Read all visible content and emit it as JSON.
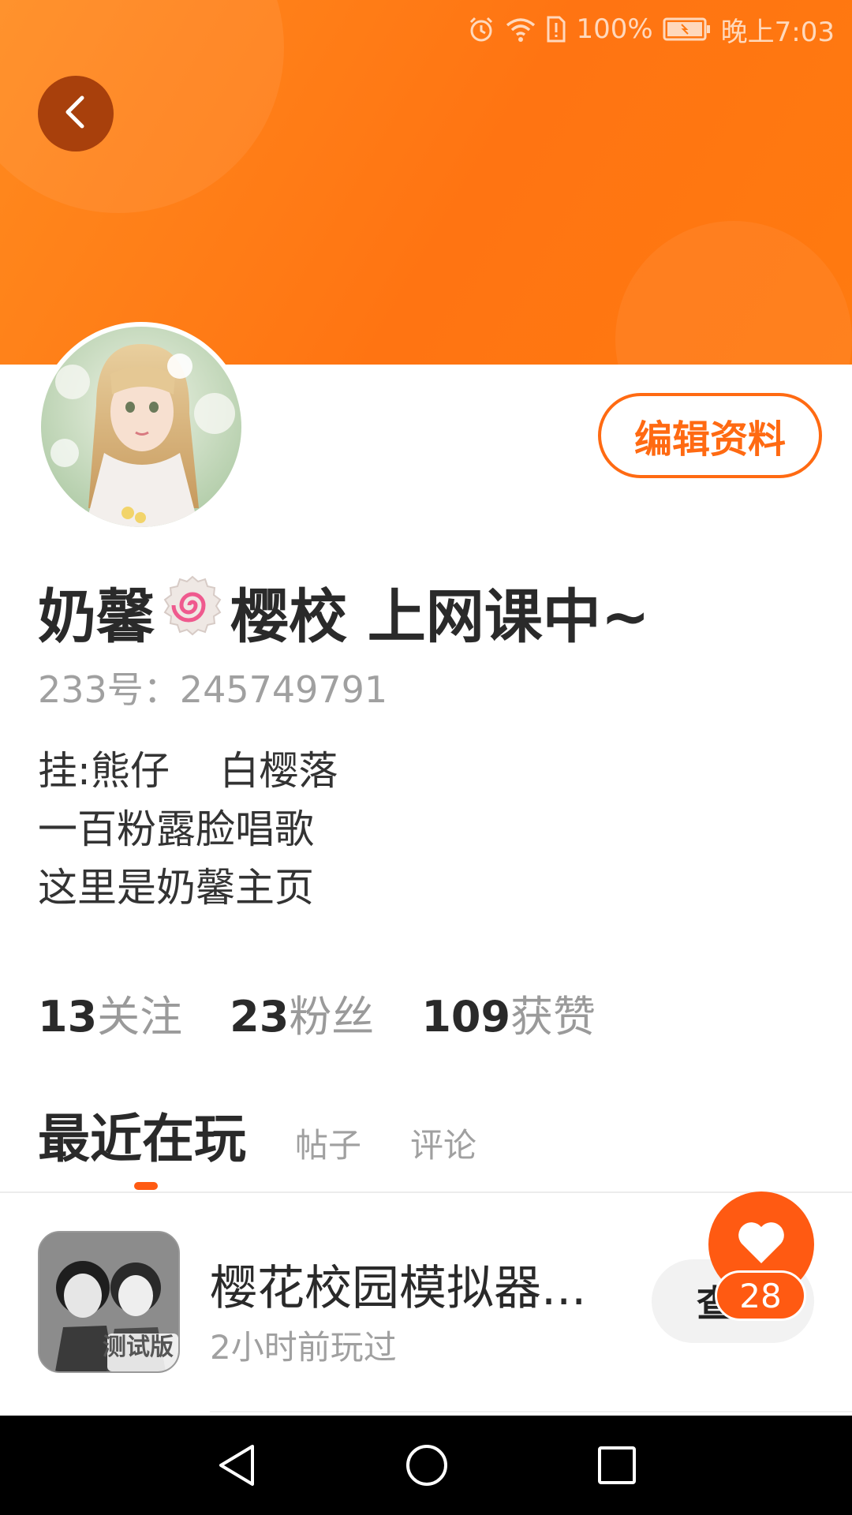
{
  "status_bar": {
    "battery_percent": "100%",
    "time": "晚上7:03"
  },
  "profile": {
    "name_part1": "奶馨",
    "name_emoji": "fishcake-emoji",
    "name_part2": "樱校  上网课中~",
    "uid": "233号：245749791",
    "bio_lines": [
      "挂:熊仔    白樱落",
      "一百粉露脸唱歌",
      "这里是奶馨主页"
    ],
    "edit_label": "编辑资料"
  },
  "stats": [
    {
      "num": "13",
      "label": "关注"
    },
    {
      "num": "23",
      "label": "粉丝"
    },
    {
      "num": "109",
      "label": "获赞"
    }
  ],
  "tabs": [
    {
      "label": "最近在玩",
      "active": true
    },
    {
      "label": "帖子",
      "active": false
    },
    {
      "label": "评论",
      "active": false
    }
  ],
  "recent_games": [
    {
      "title": "樱花校园模拟器...",
      "subtitle": "2小时前玩过",
      "button_label": "查看",
      "icon_badge": "测试版"
    }
  ],
  "like": {
    "count": "28"
  },
  "colors": {
    "accent": "#ff5a12",
    "header": "#ff7a10"
  },
  "icons": [
    "alarm-icon",
    "wifi-icon",
    "sim-alert-icon",
    "battery-icon",
    "back-icon",
    "heart-icon",
    "nav-back-icon",
    "nav-home-icon",
    "nav-recent-icon"
  ]
}
